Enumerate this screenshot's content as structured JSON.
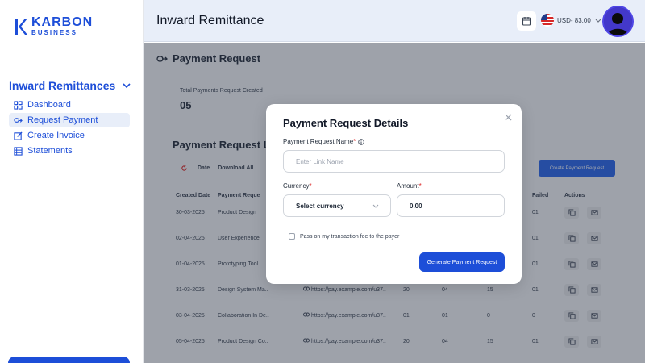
{
  "brand": {
    "name": "KARBON",
    "sub": "BUSINESS"
  },
  "sidebar": {
    "section_title": "Inward Remittances",
    "items": [
      {
        "label": "Dashboard",
        "icon": "grid-icon"
      },
      {
        "label": "Request Payment",
        "icon": "link-request-icon",
        "active": true
      },
      {
        "label": "Create Invoice",
        "icon": "edit-icon"
      },
      {
        "label": "Statements",
        "icon": "list-icon"
      }
    ]
  },
  "header": {
    "title": "Inward Remittance",
    "currency": "USD- 83.00",
    "currency_flag": "us-flag-icon"
  },
  "main": {
    "section_title": "Payment Request",
    "stat": {
      "label": "Total Payments Request Created",
      "value": "05"
    },
    "list_title": "Payment Request L",
    "toolbar": {
      "date": "Date",
      "download": "Download All",
      "generate": "Create Payment Request"
    },
    "table": {
      "headers": [
        "Created Date",
        "Payment Reque",
        "",
        "",
        "",
        "",
        "Failed",
        "Actions"
      ],
      "rows": [
        {
          "date": "30-03-2025",
          "name": "Product Design",
          "link": "",
          "n1": "",
          "n2": "",
          "n3": "",
          "failed": "01"
        },
        {
          "date": "02-04-2025",
          "name": "User Experience",
          "link": "",
          "n1": "",
          "n2": "",
          "n3": "",
          "failed": "01"
        },
        {
          "date": "01-04-2025",
          "name": "Prototyping Tool",
          "link": "",
          "n1": "",
          "n2": "",
          "n3": "",
          "failed": "01"
        },
        {
          "date": "31-03-2025",
          "name": "Design System Ma..",
          "link": "https://pay.example.com/u37..",
          "n1": "20",
          "n2": "04",
          "n3": "15",
          "failed": "01"
        },
        {
          "date": "03-04-2025",
          "name": "Collaboration In De..",
          "link": "https://pay.example.com/u37..",
          "n1": "01",
          "n2": "01",
          "n3": "0",
          "failed": "0"
        },
        {
          "date": "05-04-2025",
          "name": "Product Design Co..",
          "link": "https://pay.example.com/u37..",
          "n1": "20",
          "n2": "04",
          "n3": "15",
          "failed": "01"
        }
      ]
    }
  },
  "modal": {
    "title": "Payment Request Details",
    "name_label": "Payment Request Name",
    "name_placeholder": "Enter Link Name",
    "currency_label": "Currency",
    "currency_value": "Select currency",
    "amount_label": "Amount",
    "amount_value": "0.00",
    "checkbox_label": "Pass on my transaction fee to the payer",
    "submit_label": "Generate Payment Request"
  },
  "colors": {
    "primary": "#1d4ed8",
    "accent_bg": "#e8eef9",
    "required": "#dc2626"
  }
}
